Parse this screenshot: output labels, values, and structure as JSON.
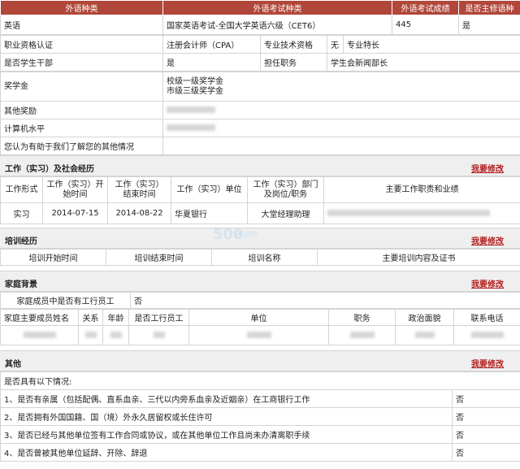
{
  "lang": {
    "headers": [
      "外语种类",
      "外语考试种类",
      "外语考试成绩",
      "是否主修语种"
    ],
    "row": {
      "type": "英语",
      "exam": "国家英语考试-全国大学英语六级（CET6）",
      "score": "445",
      "major": "是"
    }
  },
  "basic": {
    "cert_label": "职业资格认证",
    "cert_value": "注册会计师（CPA）",
    "tech_label": "专业技术资格",
    "tech_value": "无",
    "skill_label": "专业特长",
    "cadre_label": "是否学生干部",
    "cadre_value": "是",
    "post_label": "担任职务",
    "post_value": "学生会新闻部长",
    "scholar_label": "奖学金",
    "scholar_values": [
      "校级一级奖学金",
      "市级三级奖学金"
    ],
    "award_label": "其他奖励",
    "computer_label": "计算机水平",
    "other_label": "您认为有助于我们了解您的其他情况"
  },
  "work": {
    "title": "工作（实习）及社会经历",
    "edit": "我要修改",
    "headers": [
      "工作形式",
      "工作（实习）开始时间",
      "工作（实习）结束时间",
      "工作（实习）单位",
      "工作（实习）部门及岗位/职务",
      "主要工作职责和业绩"
    ],
    "row": [
      "实习",
      "2014-07-15",
      "2014-08-22",
      "华夏银行",
      "大堂经理助理"
    ]
  },
  "train": {
    "title": "培训经历",
    "edit": "我要修改",
    "headers": [
      "培训开始时间",
      "培训结束时间",
      "培训名称",
      "主要培训内容及证书"
    ]
  },
  "family": {
    "title": "家庭背景",
    "edit": "我要修改",
    "q": "家庭成员中是否有工行员工",
    "a": "否",
    "headers": [
      "家庭主要成员姓名",
      "关系",
      "年龄",
      "是否工行员工",
      "单位",
      "职务",
      "政治面貌",
      "联系电话"
    ]
  },
  "other": {
    "title": "其他",
    "edit": "我要修改",
    "intro": "是否具有以下情况:",
    "items": [
      {
        "q": "1、是否有亲属（包括配偶、直系血亲、三代以内旁系血亲及近姻亲）在工商银行工作",
        "a": "否"
      },
      {
        "q": "2、是否拥有外国国籍、国（境）外永久居留权或长住许可",
        "a": "否"
      },
      {
        "q": "3、是否已经与其他单位签有工作合同或协议，或在其他单位工作且尚未办清离职手续",
        "a": "否"
      },
      {
        "q": "4、是否曾被其他单位延辞、开除、辞退",
        "a": "否"
      }
    ]
  },
  "watermark": {
    "logo": "500",
    "site": "考试吧"
  }
}
